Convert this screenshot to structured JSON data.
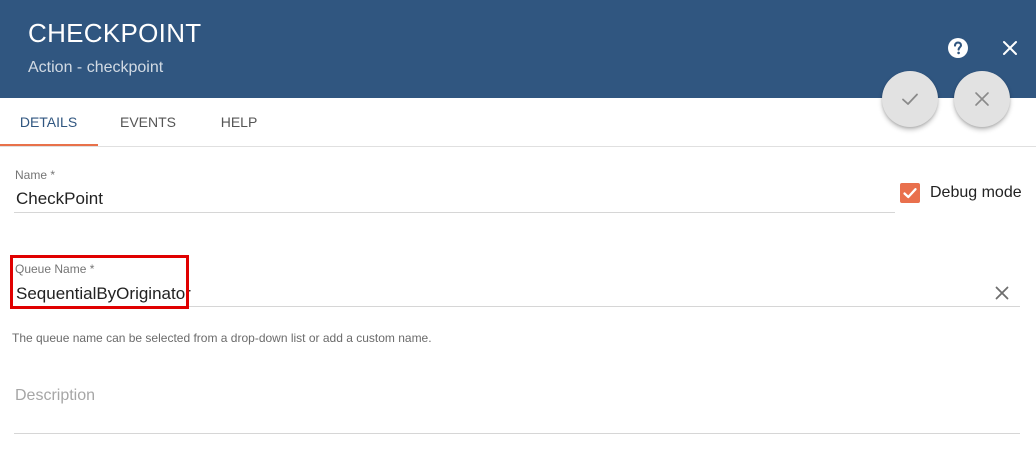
{
  "header": {
    "title": "CHECKPOINT",
    "subtitle": "Action - checkpoint",
    "help_icon": "help-circle-icon",
    "close_icon": "close-icon"
  },
  "actions": {
    "apply_icon": "check-icon",
    "cancel_icon": "close-icon"
  },
  "tabs": [
    {
      "label": "DETAILS",
      "active": true
    },
    {
      "label": "EVENTS",
      "active": false
    },
    {
      "label": "HELP",
      "active": false
    }
  ],
  "form": {
    "name": {
      "label": "Name *",
      "value": "CheckPoint"
    },
    "debug_mode": {
      "label": "Debug mode",
      "checked": true
    },
    "queue_name": {
      "label": "Queue Name *",
      "value": "SequentialByOriginator",
      "hint": "The queue name can be selected from a drop-down list or add a custom name."
    },
    "description": {
      "placeholder": "Description",
      "value": ""
    }
  },
  "colors": {
    "header_bg": "#305680",
    "accent": "#e8714a",
    "checkbox": "#e9704d",
    "highlight": "#e00000"
  }
}
